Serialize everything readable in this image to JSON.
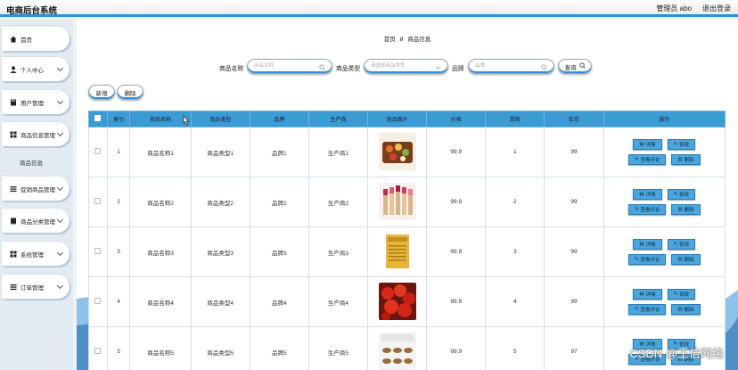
{
  "app": {
    "title": "电商后台系统",
    "user": "管理员 abo",
    "logout": "退出登录"
  },
  "sidebar": {
    "items": [
      {
        "label": "首页",
        "icon": "home-icon"
      },
      {
        "label": "个人中心",
        "icon": "user-icon"
      },
      {
        "label": "用户管理",
        "icon": "book-icon"
      },
      {
        "label": "商品信息管理",
        "icon": "grid-icon"
      },
      {
        "label": "促销商品管理",
        "icon": "list-icon"
      },
      {
        "label": "商品分类管理",
        "icon": "doc-icon"
      },
      {
        "label": "系统管理",
        "icon": "grid-icon"
      },
      {
        "label": "订单管理",
        "icon": "list-icon"
      }
    ],
    "submenu": "商品信息"
  },
  "breadcrumb": {
    "home": "首页",
    "sep": "//",
    "current": "商品信息"
  },
  "search": {
    "name_label": "商品名称",
    "name_placeholder": "商品名称",
    "type_label": "商品类型",
    "type_placeholder": "请选择商品类型",
    "brand_label": "品牌",
    "brand_placeholder": "品牌",
    "query_label": "查询"
  },
  "actions": {
    "add_label": "新增",
    "delete_label": "删除"
  },
  "table": {
    "headers": [
      "索引",
      "商品名称",
      "商品类型",
      "品牌",
      "生产商",
      "商品图片",
      "价格",
      "单限",
      "库存",
      "操作"
    ],
    "rows": [
      {
        "index": "1",
        "name": "商品名称1",
        "type": "商品类型1",
        "brand": "品牌1",
        "maker": "生产商1",
        "price": "99.9",
        "limit": "1",
        "stock": "99"
      },
      {
        "index": "2",
        "name": "商品名称2",
        "type": "商品类型2",
        "brand": "品牌2",
        "maker": "生产商2",
        "price": "99.9",
        "limit": "2",
        "stock": "99"
      },
      {
        "index": "3",
        "name": "商品名称3",
        "type": "商品类型3",
        "brand": "品牌3",
        "maker": "生产商3",
        "price": "99.9",
        "limit": "3",
        "stock": "99"
      },
      {
        "index": "4",
        "name": "商品名称4",
        "type": "商品类型4",
        "brand": "品牌4",
        "maker": "生产商4",
        "price": "99.9",
        "limit": "4",
        "stock": "99"
      },
      {
        "index": "5",
        "name": "商品名称5",
        "type": "商品类型5",
        "brand": "品牌5",
        "maker": "生产商5",
        "price": "99.9",
        "limit": "5",
        "stock": "97"
      }
    ],
    "ops": {
      "detail": "详情",
      "edit": "修改",
      "review": "查看评论",
      "delete": "删除"
    }
  },
  "watermark": "CSDN @王佶网络",
  "colors": {
    "accent": "#2f8fd8",
    "header_bg": "#3b9bd4",
    "button_bg": "#4aa6dd"
  }
}
